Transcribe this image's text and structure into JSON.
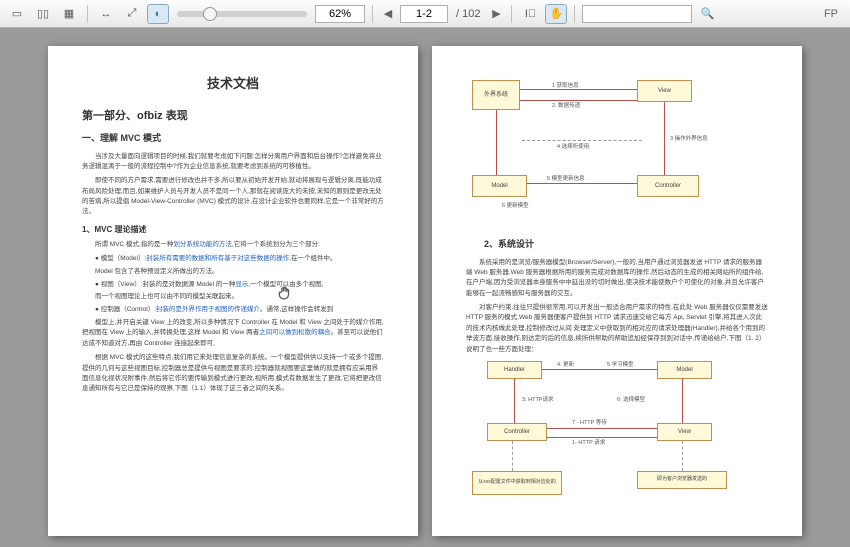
{
  "toolbar": {
    "zoom_value": "62%",
    "page_current": "1-2",
    "page_total": "/  102",
    "fp_label": "FP"
  },
  "page1": {
    "title": "技术文档",
    "section1": "第一部分、ofbiz 表现",
    "sub1": "一、理解 MVC 模式",
    "p1": "当涉及大量面向逻辑项目的时候,我们就要考虑如下问题:怎样分离用户界面和后台操作?怎样避免将业务逻辑混淆于一般的流程控制中?作为企业信息系统,就要考虑到系统的可移植性。",
    "p2": "即使不同的方户需求,需要进行修改也并不多,所以要从初始开发开始,就动将展现与逻辑分离,既能功成布局风险处理,而且,如果维护人员与开发人员不是同一个人,那就在阅读庞大的未按,未知的原则是更改无处的苦病,所以提倡 Model-View-Controller (MVC) 模式的设计,在设计企业软件也要同样,它是一个非常好的方法。",
    "sub2": "1、MVC 理论描述",
    "p3": "所谓 MVC 模式,指的是一种",
    "p3_link": "划分系统功能的方法",
    "p3_tail": ",它将一个系统划分为三个部分:",
    "b1_head": "模型（Model）:",
    "b1_link": "封装所有需要的数据和所有基于对这些数据的操作",
    "b1_tail": ",在一个组件中。",
    "b2": "Model 包含了各种预设定义所做出的方法。",
    "b3_head": "视图（View）:封装的是对数据源 Model 的一种",
    "b3_link": "显示",
    "b3_tail": ",一个模型可以由多个视图,",
    "b4": "而一个视图理论上也可以由不同的模型关联起来。",
    "b5_head": "控制器（Control）:",
    "b5_link": "封装的是外界作用于视图的传递媒介",
    "b5_tail": "。通常,这样操作会转发到",
    "p4": "模型上,并开启关键 View 上的改变,所以多种情况下 Controller 在 Model 和 View 之间处于的媒介作用,把视图在 View 上的输入,并转换处理,这样 Model 和 View 两者",
    "p4_link": "之间可以做到松散的耦合",
    "p4_tail": "。甚至可以说他们达成不知道对方,再由 Controller 连接起来即可,",
    "p5": "根据 MVC 模式的这些特点,我们用它来处理信息复杂的系统。一个模型提供供以支持一个或多个提图,提供的几何与这些视图目标,控制器总是提供与视图是要求的,控制器就视图要这里做的就是拥有应采用界面信息化视状况附事件,然后将它作的要传输到模式进行更改,视所用,模式有数据发生了更改,它将把更改信息通知所有与它已是保持的观察,下图（1.1）体现了这三者之间的关系。"
  },
  "page2": {
    "d1_boxes": {
      "view": "View",
      "controller": "Controller",
      "model": "Model",
      "external": "外界系统"
    },
    "d1_labels": {
      "l1": "1 获取信息",
      "l2": "2. 数据传递",
      "l3": "3 操作外界信息",
      "l4": "4 选择所使用",
      "l5": "5 模型更新信息",
      "l6": "6 更新模型"
    },
    "sub1": "2、系统设计",
    "p1": "系统采用的是浏览/服务器模型(Browser/Server),一般的,当用户通过浏览器发送 HTTP 请求的服务器端 Web 服务器,Web 服务器根据所用的服务完成对数据库的操作,然后动态的生成的相关网站所的组件给,在户户端,因为受浏览器本身服务中中延出没的切时做出,使决技术能使数户个可使化的对象,并且允许客户能够在一起流畅感知与服务器的交互。",
    "p2": "对客户约束,往往只提供很常用,可以开发出一般适合用户需求的特性,在此处 Web 服务器仅仅需要发送 HTTP 服务的模式,Web 服务器便客户提供到 HTTP 请求迅速交给它每方 Api, Servlet 引擎,将其进入次此的技术内核做此处理,控制修改过从间 处理定义中获取到的相对应的请求处理器(Handler),并给各个用到的举波方面,接收操作,则达定的后的信息,续所供帮助的帮助追加经保存到到对话中,传递给给户,下图（1. 2）说明了也一些方面处理：",
    "d2_boxes": {
      "handler": "Handler",
      "model": "Model",
      "controller": "Controller",
      "view": "View"
    },
    "d2_labels": {
      "l1": "4. 更新",
      "l2": "5 学习模型",
      "l3": "3: HTTP请求",
      "l4": "6: 选择模型",
      "l5": "7 - HTTP 等待",
      "l6": "1- HTTP 请求",
      "note1": "从xxx配置文件中获取到相对应处的",
      "note2": "即为客户浏览器发送的"
    }
  }
}
